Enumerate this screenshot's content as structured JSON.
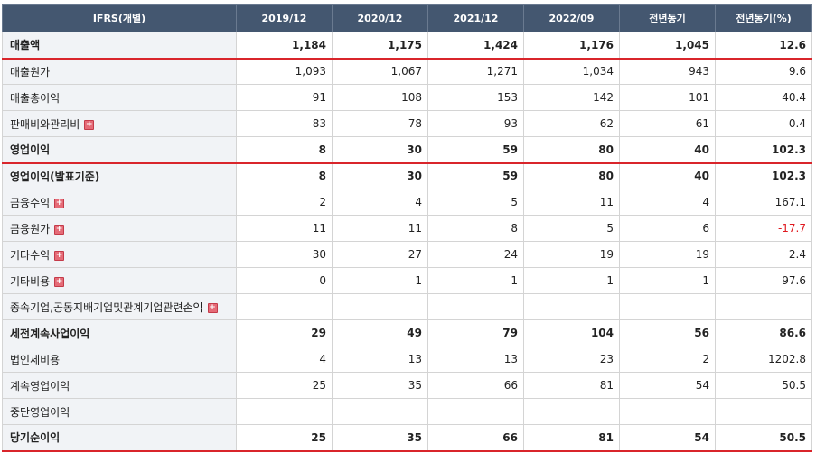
{
  "header": {
    "label": "IFRS(개별)",
    "columns": [
      "2019/12",
      "2020/12",
      "2021/12",
      "2022/09",
      "전년동기",
      "전년동기(%)"
    ]
  },
  "rows": [
    {
      "label": "매출액",
      "values": [
        "1,184",
        "1,175",
        "1,424",
        "1,176",
        "1,045",
        "12.6"
      ],
      "bold": true,
      "redline": true,
      "expandable": false
    },
    {
      "label": "매출원가",
      "values": [
        "1,093",
        "1,067",
        "1,271",
        "1,034",
        "943",
        "9.6"
      ],
      "bold": false,
      "redline": false,
      "expandable": false
    },
    {
      "label": "매출총이익",
      "values": [
        "91",
        "108",
        "153",
        "142",
        "101",
        "40.4"
      ],
      "bold": false,
      "redline": false,
      "expandable": false
    },
    {
      "label": "판매비와관리비",
      "values": [
        "83",
        "78",
        "93",
        "62",
        "61",
        "0.4"
      ],
      "bold": false,
      "redline": false,
      "expandable": true
    },
    {
      "label": "영업이익",
      "values": [
        "8",
        "30",
        "59",
        "80",
        "40",
        "102.3"
      ],
      "bold": true,
      "redline": true,
      "expandable": false
    },
    {
      "label": "영업이익(발표기준)",
      "values": [
        "8",
        "30",
        "59",
        "80",
        "40",
        "102.3"
      ],
      "bold": true,
      "redline": false,
      "expandable": false
    },
    {
      "label": "금융수익",
      "values": [
        "2",
        "4",
        "5",
        "11",
        "4",
        "167.1"
      ],
      "bold": false,
      "redline": false,
      "expandable": true
    },
    {
      "label": "금융원가",
      "values": [
        "11",
        "11",
        "8",
        "5",
        "6",
        "-17.7"
      ],
      "bold": false,
      "redline": false,
      "expandable": true
    },
    {
      "label": "기타수익",
      "values": [
        "30",
        "27",
        "24",
        "19",
        "19",
        "2.4"
      ],
      "bold": false,
      "redline": false,
      "expandable": true
    },
    {
      "label": "기타비용",
      "values": [
        "0",
        "1",
        "1",
        "1",
        "1",
        "97.6"
      ],
      "bold": false,
      "redline": false,
      "expandable": true
    },
    {
      "label": "종속기업,공동지배기업및관계기업관련손익",
      "values": [
        "",
        "",
        "",
        "",
        "",
        ""
      ],
      "bold": false,
      "redline": false,
      "expandable": true
    },
    {
      "label": "세전계속사업이익",
      "values": [
        "29",
        "49",
        "79",
        "104",
        "56",
        "86.6"
      ],
      "bold": true,
      "redline": false,
      "expandable": false
    },
    {
      "label": "법인세비용",
      "values": [
        "4",
        "13",
        "13",
        "23",
        "2",
        "1202.8"
      ],
      "bold": false,
      "redline": false,
      "expandable": false
    },
    {
      "label": "계속영업이익",
      "values": [
        "25",
        "35",
        "66",
        "81",
        "54",
        "50.5"
      ],
      "bold": false,
      "redline": false,
      "expandable": false
    },
    {
      "label": "중단영업이익",
      "values": [
        "",
        "",
        "",
        "",
        "",
        ""
      ],
      "bold": false,
      "redline": false,
      "expandable": false
    },
    {
      "label": "당기순이익",
      "values": [
        "25",
        "35",
        "66",
        "81",
        "54",
        "50.5"
      ],
      "bold": true,
      "redline": true,
      "expandable": false
    }
  ],
  "colors": {
    "header_bg": "#445770",
    "accent_red": "#d9252b",
    "negative": "#e0191f",
    "expand_icon": "#e56b77"
  },
  "icons": {
    "expand": "plus-box-icon"
  }
}
